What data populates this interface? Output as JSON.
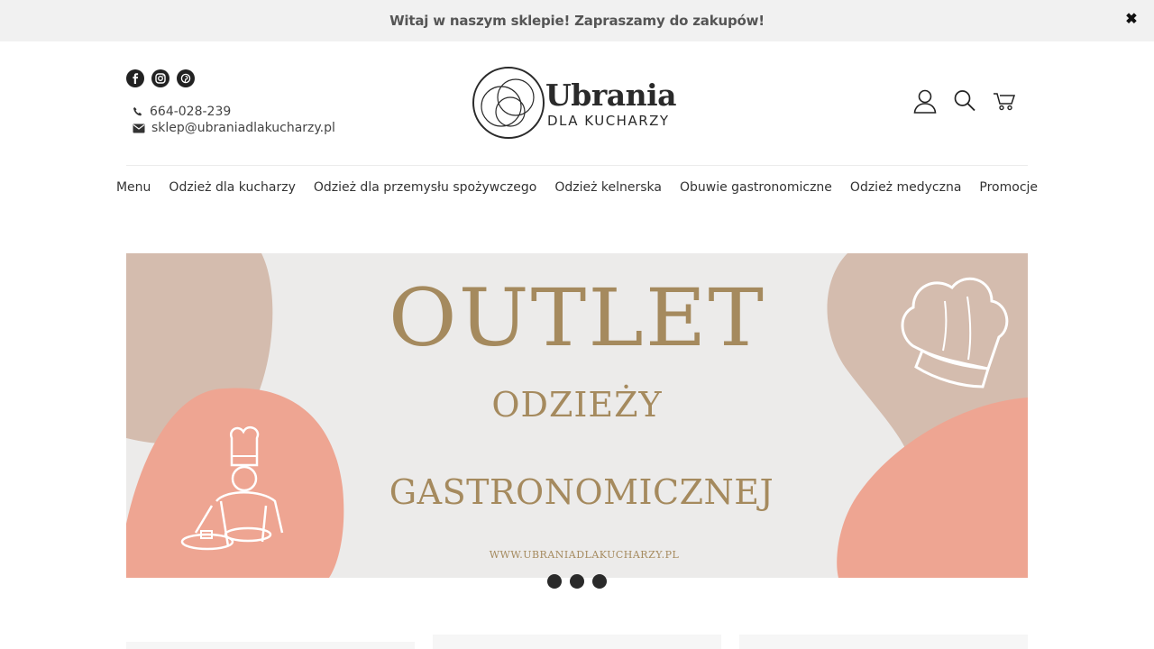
{
  "announcement": {
    "text": "Witaj w naszym sklepie! Zapraszamy do zakupów!",
    "close_glyph": "✖"
  },
  "header": {
    "social": [
      {
        "icon": "facebook-icon"
      },
      {
        "icon": "instagram-icon"
      },
      {
        "icon": "pinterest-icon"
      }
    ],
    "phone": "664-028-239",
    "email": "sklep@ubraniadlakucharzy.pl",
    "logo": {
      "title": "Ubrania",
      "subtitle": "DLA KUCHARZY"
    },
    "icons": [
      "account-icon",
      "search-icon",
      "cart-icon"
    ]
  },
  "nav": {
    "items": [
      "Menu",
      "Odzież dla kucharzy",
      "Odzież dla przemysłu spożywczego",
      "Odzież kelnerska",
      "Obuwie gastronomiczne",
      "Odzież medyczna",
      "Promocje"
    ]
  },
  "banner": {
    "title": "OUTLET",
    "line1": "ODZIEŻY",
    "line2": "GASTRONOMICZNEJ",
    "url": "WWW.UBRANIADLAKUCHARZY.PL",
    "slides": 3,
    "colors": {
      "background": "#ecebea",
      "taupe": "#d4bcae",
      "salmon": "#eea592",
      "gold": "#a58a5e"
    }
  }
}
